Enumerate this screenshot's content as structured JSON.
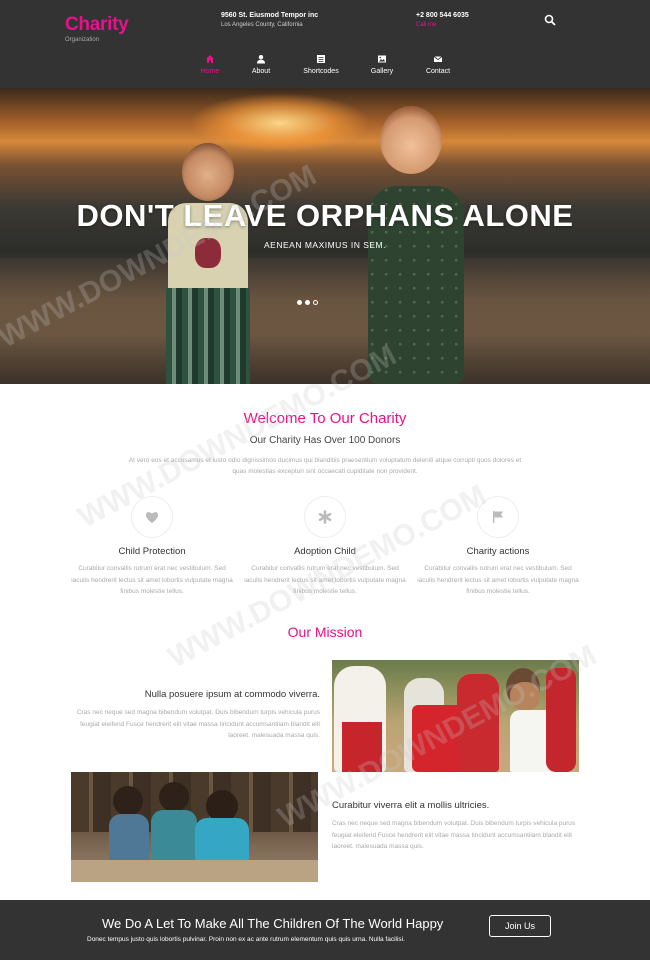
{
  "header": {
    "logo": {
      "name": "Charity",
      "sub": "Organization"
    },
    "address": {
      "line1": "9560 St. Eiusmod Tempor inc",
      "line2": "Los Angeles County, California"
    },
    "phone": {
      "line1": "+2 800 544 6035",
      "line2": "Call me"
    },
    "nav": [
      {
        "label": "Home",
        "icon": "home-icon",
        "active": true
      },
      {
        "label": "About",
        "icon": "user-icon"
      },
      {
        "label": "Shortcodes",
        "icon": "list-icon"
      },
      {
        "label": "Gallery",
        "icon": "image-icon"
      },
      {
        "label": "Contact",
        "icon": "mail-icon"
      }
    ]
  },
  "hero": {
    "title": "DON'T LEAVE ORPHANS ALONE",
    "subtitle": "AENEAN MAXIMUS IN SEM.",
    "slides": 3,
    "active_slide": 1
  },
  "welcome": {
    "title": "Welcome To Our Charity",
    "subtitle": "Our Charity Has Over 100 Donors",
    "text": "At vero eos et accusamus et iusto odio dignissimos ducimus qui blanditiis praesentium voluptatum deleniti atque corrupti quos dolores et quas molestias excepturi sint occaecati cupiditate non provident."
  },
  "features": [
    {
      "icon": "heart-icon",
      "title": "Child Protection",
      "text": "Curabitur convallis rutrum erat nec vestibulum. Sed iaculis hendrerit lectus sit amet lobortis vulputate magna finibus molestie tellus."
    },
    {
      "icon": "asterisk-icon",
      "title": "Adoption Child",
      "text": "Curabitur convallis rutrum erat nec vestibulum. Sed iaculis hendrerit lectus sit amet lobortis vulputate magna finibus molestie tellus."
    },
    {
      "icon": "flag-icon",
      "title": "Charity actions",
      "text": "Curabitur convallis rutrum erat nec vestibulum. Sed iaculis hendrerit lectus sit amet lobortis vulputate magna finibus molestie tellus."
    }
  ],
  "mission": {
    "title": "Our Mission",
    "block1": {
      "heading": "Nulla posuere ipsum at commodo viverra.",
      "text": "Cras nec neque sed magna bibendum volutpat. Duis bibendum turpis vehicula purus feugiat eleifend Fusce hendrerit elit vitae massa tincidunt accumsantiiam blandit elit laoreet. malesuada massa quis."
    },
    "block2": {
      "heading": "Curabitur viverra elit a mollis ultricies.",
      "text": "Cras nec neque sed magna bibendum volutpat. Duis bibendum turpis vehicula purus feugiat eleifend Fusce hendrerit elit vitae massa tincidunt accumsantiiam blandit elit laoreet. malesuada massa quis."
    }
  },
  "footer": {
    "title": "We Do A Let To Make All The Children Of The World Happy",
    "text": "Donec tempus justo quis lobortis pulvinar. Proin non ex ac ante rutrum elementum quis quis urna. Nulla facilisi.",
    "button": "Join Us"
  },
  "watermark": "WWW.DOWNDEMO.COM",
  "colors": {
    "accent": "#e7128a",
    "dark": "#333333"
  }
}
